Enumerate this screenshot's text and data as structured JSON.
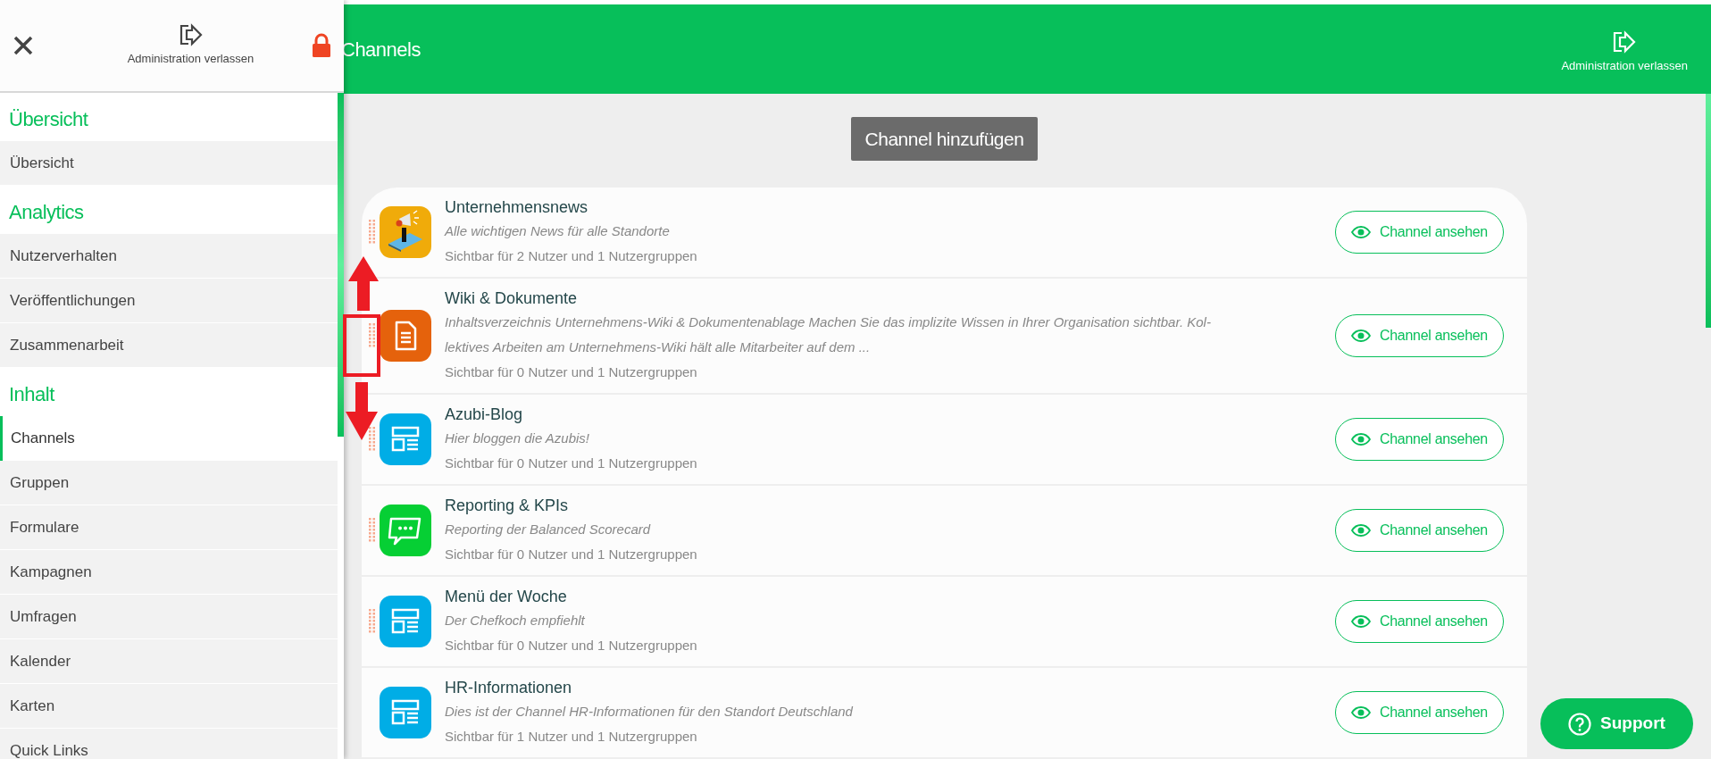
{
  "sidebar": {
    "exit_label": "Administration verlassen",
    "sections": [
      {
        "title": "Übersicht",
        "items": [
          {
            "label": "Übersicht",
            "selected": false
          }
        ]
      },
      {
        "title": "Analytics",
        "items": [
          {
            "label": "Nutzerverhalten",
            "selected": false
          },
          {
            "label": "Veröffentlichungen",
            "selected": false
          },
          {
            "label": "Zusammenarbeit",
            "selected": false
          }
        ]
      },
      {
        "title": "Inhalt",
        "items": [
          {
            "label": "Channels",
            "selected": true
          },
          {
            "label": "Gruppen",
            "selected": false
          },
          {
            "label": "Formulare",
            "selected": false
          },
          {
            "label": "Kampagnen",
            "selected": false
          },
          {
            "label": "Umfragen",
            "selected": false
          },
          {
            "label": "Kalender",
            "selected": false
          },
          {
            "label": "Karten",
            "selected": false
          },
          {
            "label": "Quick Links",
            "selected": false
          }
        ]
      }
    ]
  },
  "header": {
    "title": "Channels",
    "exit_label": "Administration verlassen"
  },
  "add_button": "Channel hinzufügen",
  "channels": [
    {
      "title": "Unternehmensnews",
      "description": [
        "Alle wichtigen News für alle Standorte"
      ],
      "visibility": "Sichtbar für 2 Nutzer und 1 Nutzergruppen",
      "kind": "megaphone",
      "draggable": true,
      "button": "Channel ansehen"
    },
    {
      "title": "Wiki & Dokumente",
      "description": [
        "Inhaltsverzeichnis Unternehmens-Wiki & Dokumentenablage Machen Sie das implizite Wissen in Ihrer Organisation sichtbar. Kol-",
        "lektives Arbeiten am Unternehmens-Wiki hält alle Mitarbeiter auf dem ..."
      ],
      "visibility": "Sichtbar für 0 Nutzer und 1 Nutzergruppen",
      "kind": "document",
      "draggable": true,
      "button": "Channel ansehen"
    },
    {
      "title": "Azubi-Blog",
      "description": [
        "Hier bloggen die Azubis!"
      ],
      "visibility": "Sichtbar für 0 Nutzer und 1 Nutzergruppen",
      "kind": "layout",
      "draggable": true,
      "button": "Channel ansehen"
    },
    {
      "title": "Reporting & KPIs",
      "description": [
        "Reporting der Balanced Scorecard"
      ],
      "visibility": "Sichtbar für 0 Nutzer und 1 Nutzergruppen",
      "kind": "chat",
      "draggable": true,
      "button": "Channel ansehen"
    },
    {
      "title": "Menü der Woche",
      "description": [
        "Der Chefkoch empfiehlt"
      ],
      "visibility": "Sichtbar für 0 Nutzer und 1 Nutzergruppen",
      "kind": "layout",
      "draggable": true,
      "button": "Channel ansehen"
    },
    {
      "title": "HR-Informationen",
      "description": [
        "Dies ist der Channel HR-Informationen für den Standort Deutschland"
      ],
      "visibility": "Sichtbar für 1 Nutzer und 1 Nutzergruppen",
      "kind": "layout",
      "draggable": false,
      "button": "Channel ansehen"
    }
  ],
  "annotations": [
    {
      "kind": "arrow_up"
    },
    {
      "kind": "box"
    },
    {
      "kind": "arrow_down"
    }
  ],
  "support_button": "Support"
}
